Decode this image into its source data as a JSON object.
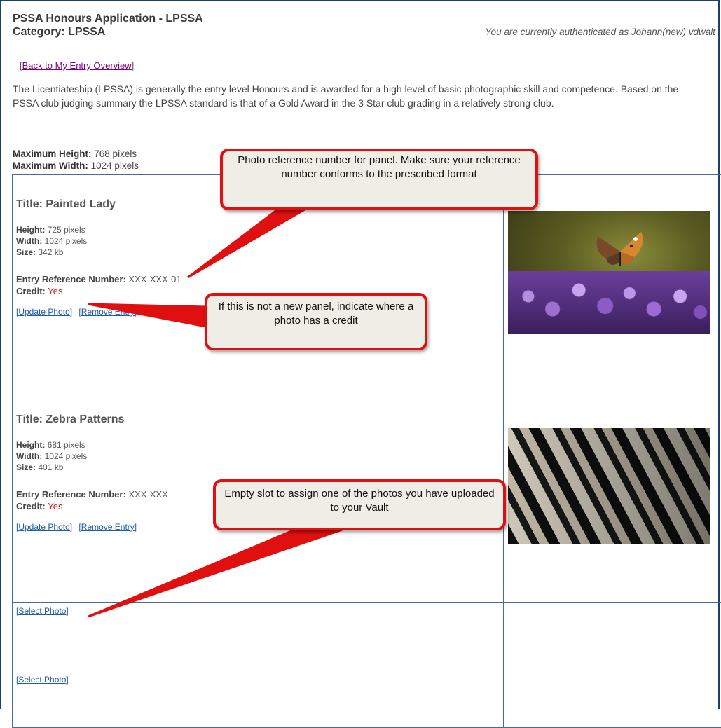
{
  "header": {
    "title_line1": "PSSA Honours Application - LPSSA",
    "title_line2": "Category: LPSSA",
    "auth_text": "You are currently authenticated as Johann(new) vdwalt"
  },
  "nav": {
    "back_link": "Back to My Entry Overview"
  },
  "description": "The Licentiateship (LPSSA) is generally the entry level Honours and is awarded for a high level of basic photographic skill and competence. Based on the PSSA club judging summary the LPSSA standard is that of a Gold Award in the 3 Star club grading in a relatively strong club.",
  "limits": {
    "max_height_label": "Maximum Height:",
    "max_height_value": "768 pixels",
    "max_width_label": "Maximum Width:",
    "max_width_value": "1024 pixels"
  },
  "labels": {
    "height": "Height:",
    "width": "Width:",
    "size": "Size:",
    "ref": "Entry Reference Number:",
    "credit": "Credit:",
    "update": "Update Photo",
    "remove": "Remove Entry",
    "select": "Select Photo"
  },
  "entries": [
    {
      "title": "Title: Painted Lady",
      "height": "725 pixels",
      "width": "1024 pixels",
      "size": "342 kb",
      "ref": "XXX-XXX-01",
      "credit": "Yes",
      "image": "butterfly-photo"
    },
    {
      "title": "Title: Zebra Patterns",
      "height": "681 pixels",
      "width": "1024 pixels",
      "size": "401 kb",
      "ref": "XXX-XXX",
      "credit": "Yes",
      "image": "zebra-photo"
    }
  ],
  "empty_slots": [
    {
      "link": "Select Photo"
    },
    {
      "link": "Select Photo"
    }
  ],
  "callouts": {
    "reference": "Photo reference number for panel.  Make sure your reference number conforms to  the prescribed format",
    "credit": "If this is not a new panel, indicate where a photo has a credit",
    "empty_slot": "Empty slot to assign one of the photos you have uploaded to your Vault"
  },
  "colors": {
    "frame": "#1c3f6e",
    "link": "#1e5ca8",
    "visited_link": "#800080",
    "credit": "#c02020",
    "callout_border": "#e01010",
    "callout_fill": "#efeee6"
  }
}
